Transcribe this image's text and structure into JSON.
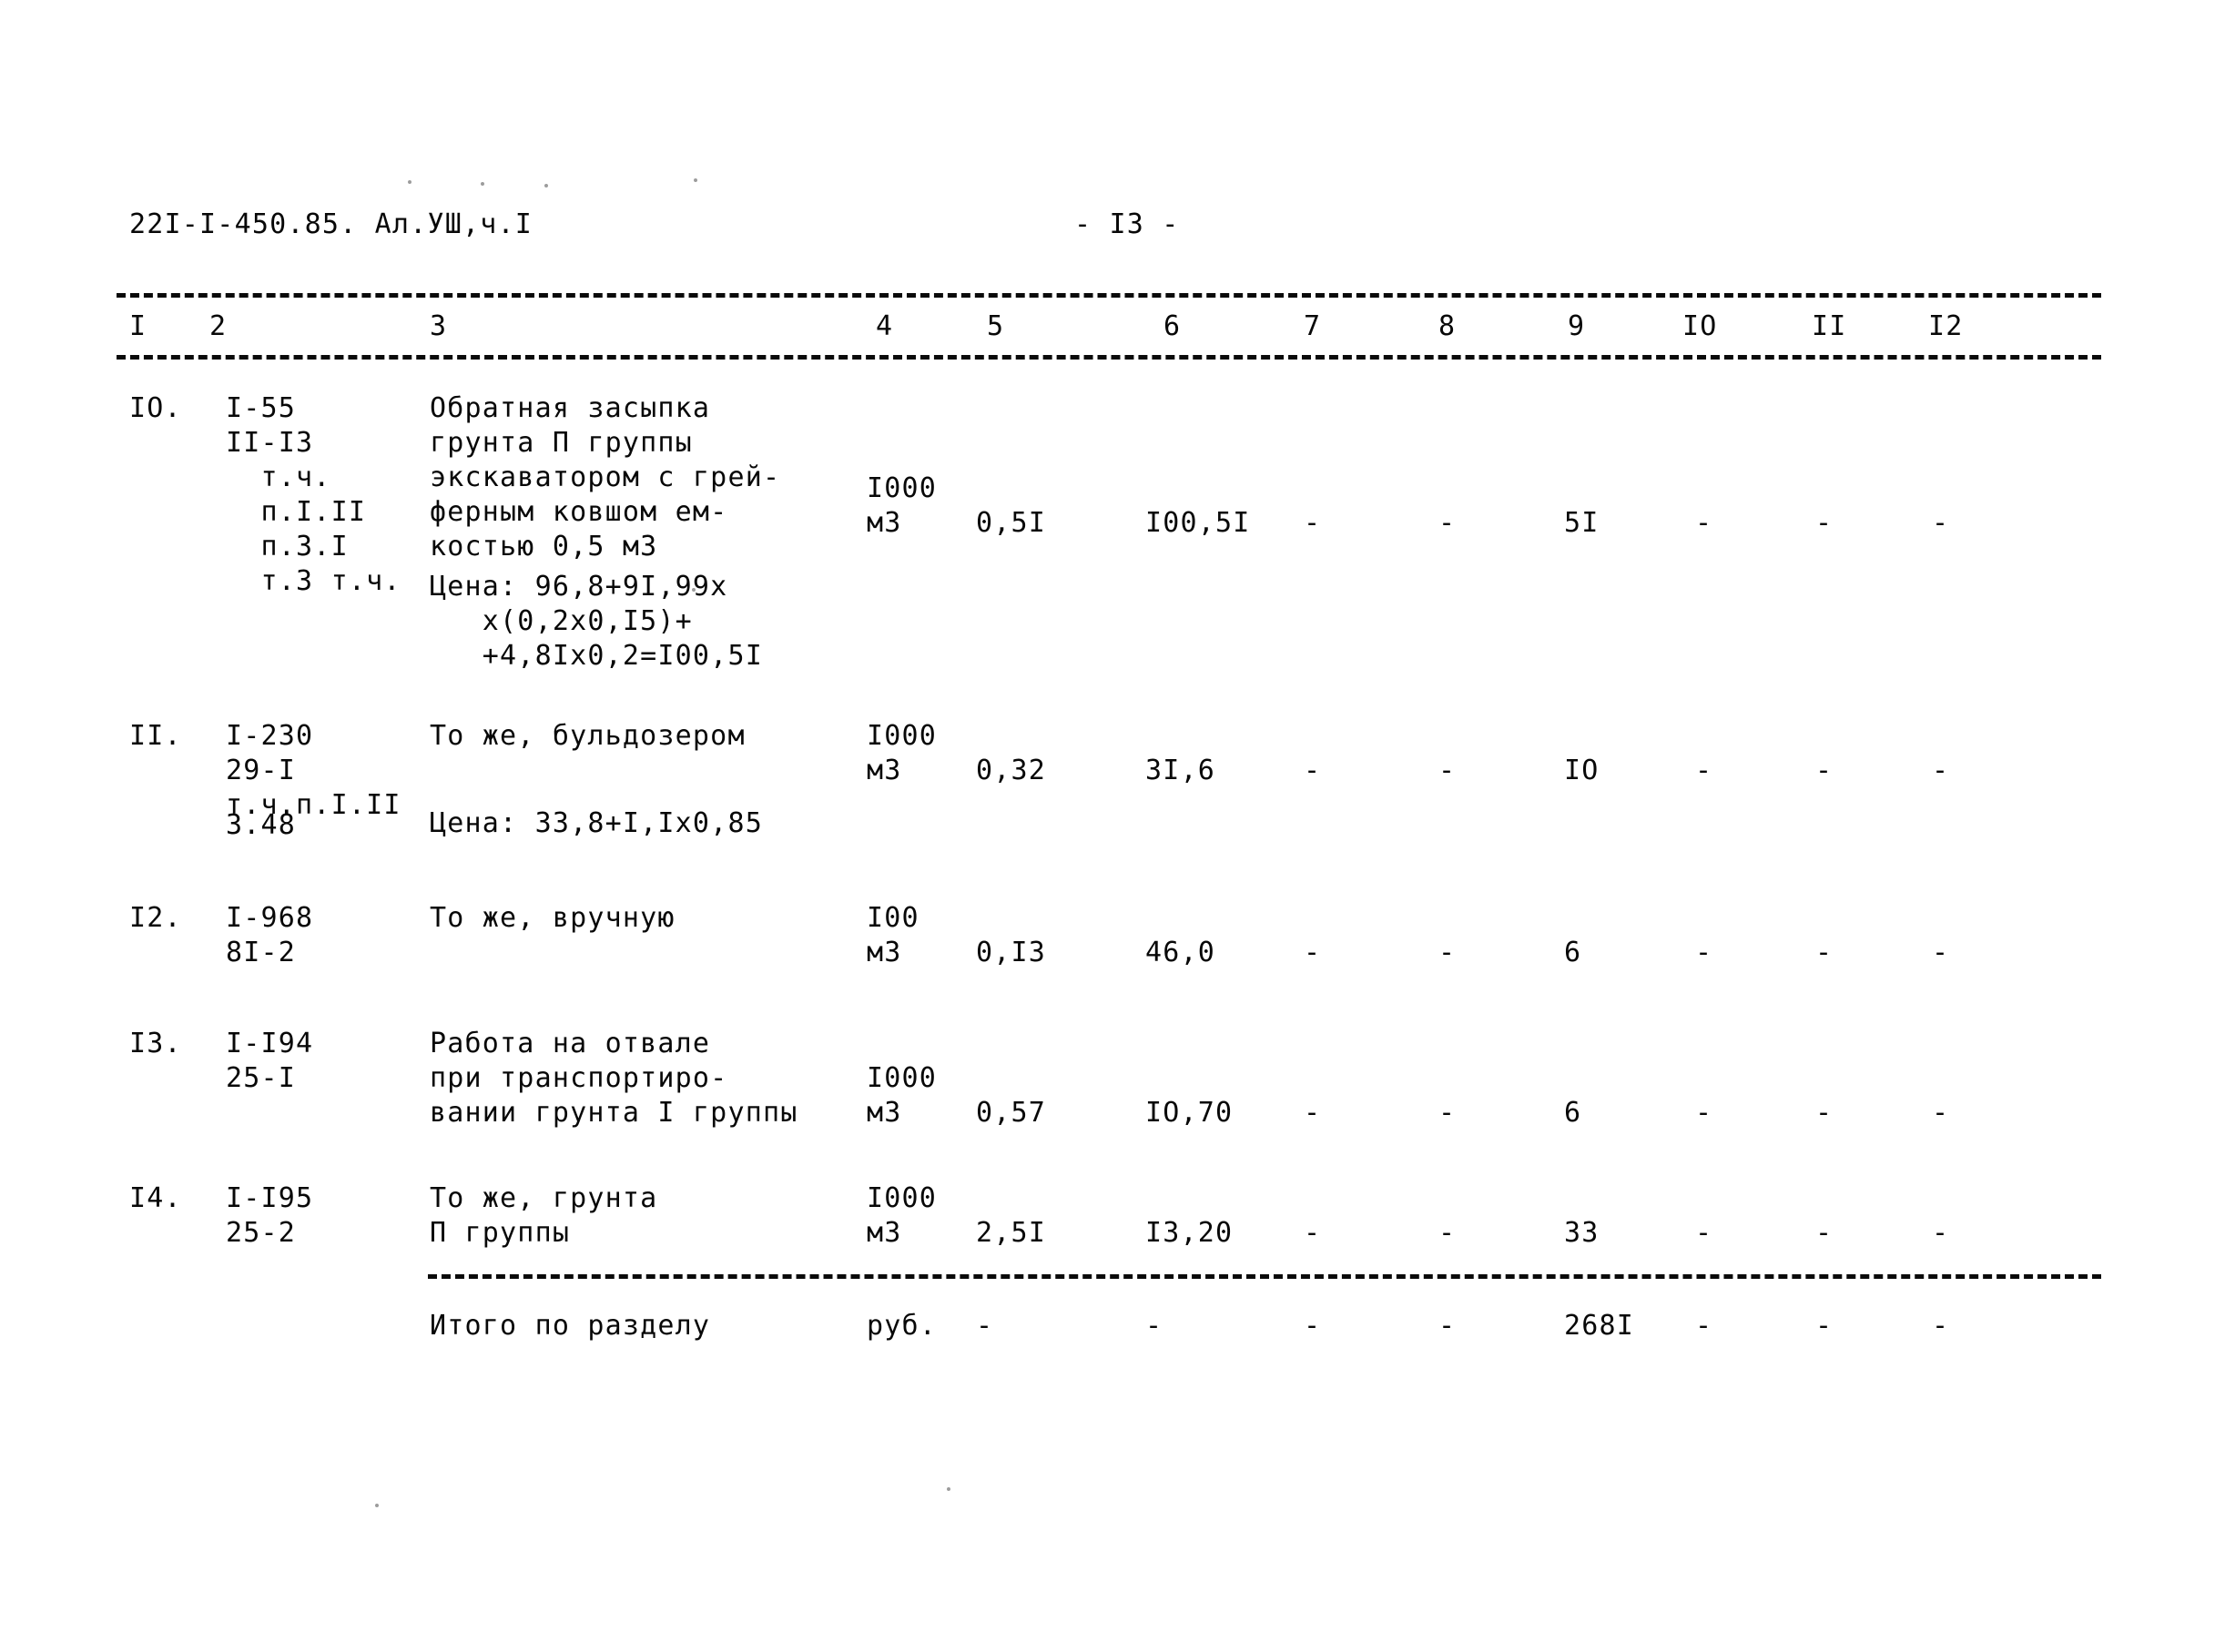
{
  "document": {
    "code": "22I-I-450.85. Ал.УШ,ч.I",
    "page_marker": "- I3 -"
  },
  "table": {
    "column_headers": [
      "I",
      "2",
      "3",
      "4",
      "5",
      "6",
      "7",
      "8",
      "9",
      "IO",
      "II",
      "I2"
    ],
    "rows": [
      {
        "no": "IO.",
        "code": "I-55\nII-I3\n  т.ч.\n  п.I.II\n  п.3.I\n  т.3 т.ч.",
        "description": "Обратная засыпка\nгрунта П группы\nэкскаватором с грей-\nферным ковшом ем-\nкостью 0,5 м3",
        "note": "Цена: 96,8+9I,99х\n   х(0,2х0,I5)+\n   +4,8Iх0,2=I00,5I",
        "unit": "I000\nм3",
        "c5": "0,5I",
        "c6": "I00,5I",
        "c7": "-",
        "c8": "-",
        "c9": "5I",
        "c10": "-",
        "c11": "-",
        "c12": "-"
      },
      {
        "no": "II.",
        "code": "I-230\n29-I\nт.ч.п.I.II",
        "code_overlay": "3.48",
        "description": "То же, бульдозером",
        "note": "Цена: 33,8+I,Iх0,85",
        "unit": "I000\nм3",
        "c5": "0,32",
        "c6": "3I,6",
        "c7": "-",
        "c8": "-",
        "c9": "IO",
        "c10": "-",
        "c11": "-",
        "c12": "-"
      },
      {
        "no": "I2.",
        "code": "I-968\n8I-2",
        "description": "То же, вручную",
        "note": "",
        "unit": "I00\nм3",
        "c5": "0,I3",
        "c6": "46,0",
        "c7": "-",
        "c8": "-",
        "c9": "6",
        "c10": "-",
        "c11": "-",
        "c12": "-"
      },
      {
        "no": "I3.",
        "code": "I-I94\n25-I",
        "description": "Работа на отвале\nпри транспортиро-\nвании грунта I группы",
        "note": "",
        "unit": "I000\nм3",
        "c5": "0,57",
        "c6": "IO,70",
        "c7": "-",
        "c8": "-",
        "c9": "6",
        "c10": "-",
        "c11": "-",
        "c12": "-"
      },
      {
        "no": "I4.",
        "code": "I-I95\n25-2",
        "description": "То же, грунта\nП группы",
        "note": "",
        "unit": "I000\nм3",
        "c5": "2,5I",
        "c6": "I3,20",
        "c7": "-",
        "c8": "-",
        "c9": "33",
        "c10": "-",
        "c11": "-",
        "c12": "-"
      }
    ],
    "total_row": {
      "label": "Итого по разделу",
      "unit": "руб.",
      "c5": "-",
      "c6": "-",
      "c7": "-",
      "c8": "-",
      "c9": "268I",
      "c10": "-",
      "c11": "-",
      "c12": "-"
    }
  }
}
